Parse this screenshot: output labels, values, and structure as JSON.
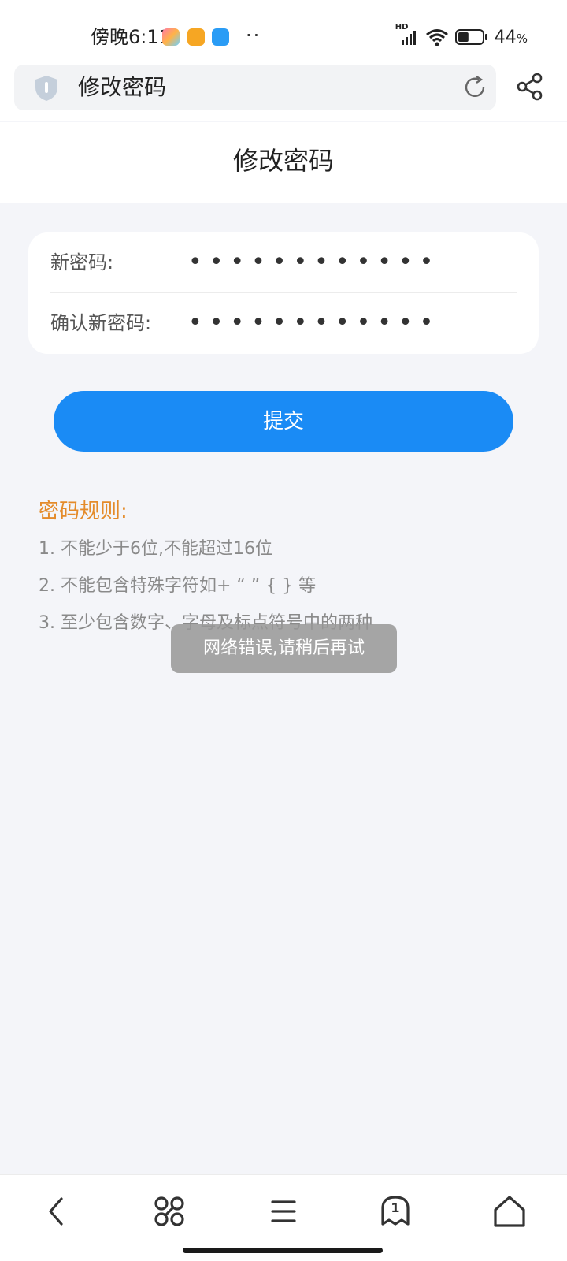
{
  "status_bar": {
    "time": "傍晚6:11",
    "dots": "··",
    "network": "HD",
    "battery_percent": "44",
    "battery_unit": "%",
    "battery_level": 0.44
  },
  "browser": {
    "address_title": "修改密码"
  },
  "page": {
    "title": "修改密码"
  },
  "form": {
    "new_password_label": "新密码:",
    "new_password_value": "••••••••••••",
    "confirm_password_label": "确认新密码:",
    "confirm_password_value": "••••••••••••",
    "submit_label": "提交"
  },
  "rules": {
    "title": "密码规则:",
    "items": [
      "1. 不能少于6位,不能超过16位",
      "2. 不能包含特殊字符如+ “ ” { } 等",
      "3. 至少包含数字、字母及标点符号中的两种"
    ]
  },
  "toast": {
    "message": "网络错误,请稍后再试"
  },
  "bottom_nav": {
    "tab_count": "1"
  },
  "colors": {
    "accent": "#1a8bf5",
    "rules_title": "#e48b2a",
    "background": "#f4f5f9"
  },
  "icons": [
    "shield-icon",
    "reload-icon",
    "share-icon",
    "back-icon",
    "command-icon",
    "menu-icon",
    "tabs-icon",
    "home-icon"
  ]
}
